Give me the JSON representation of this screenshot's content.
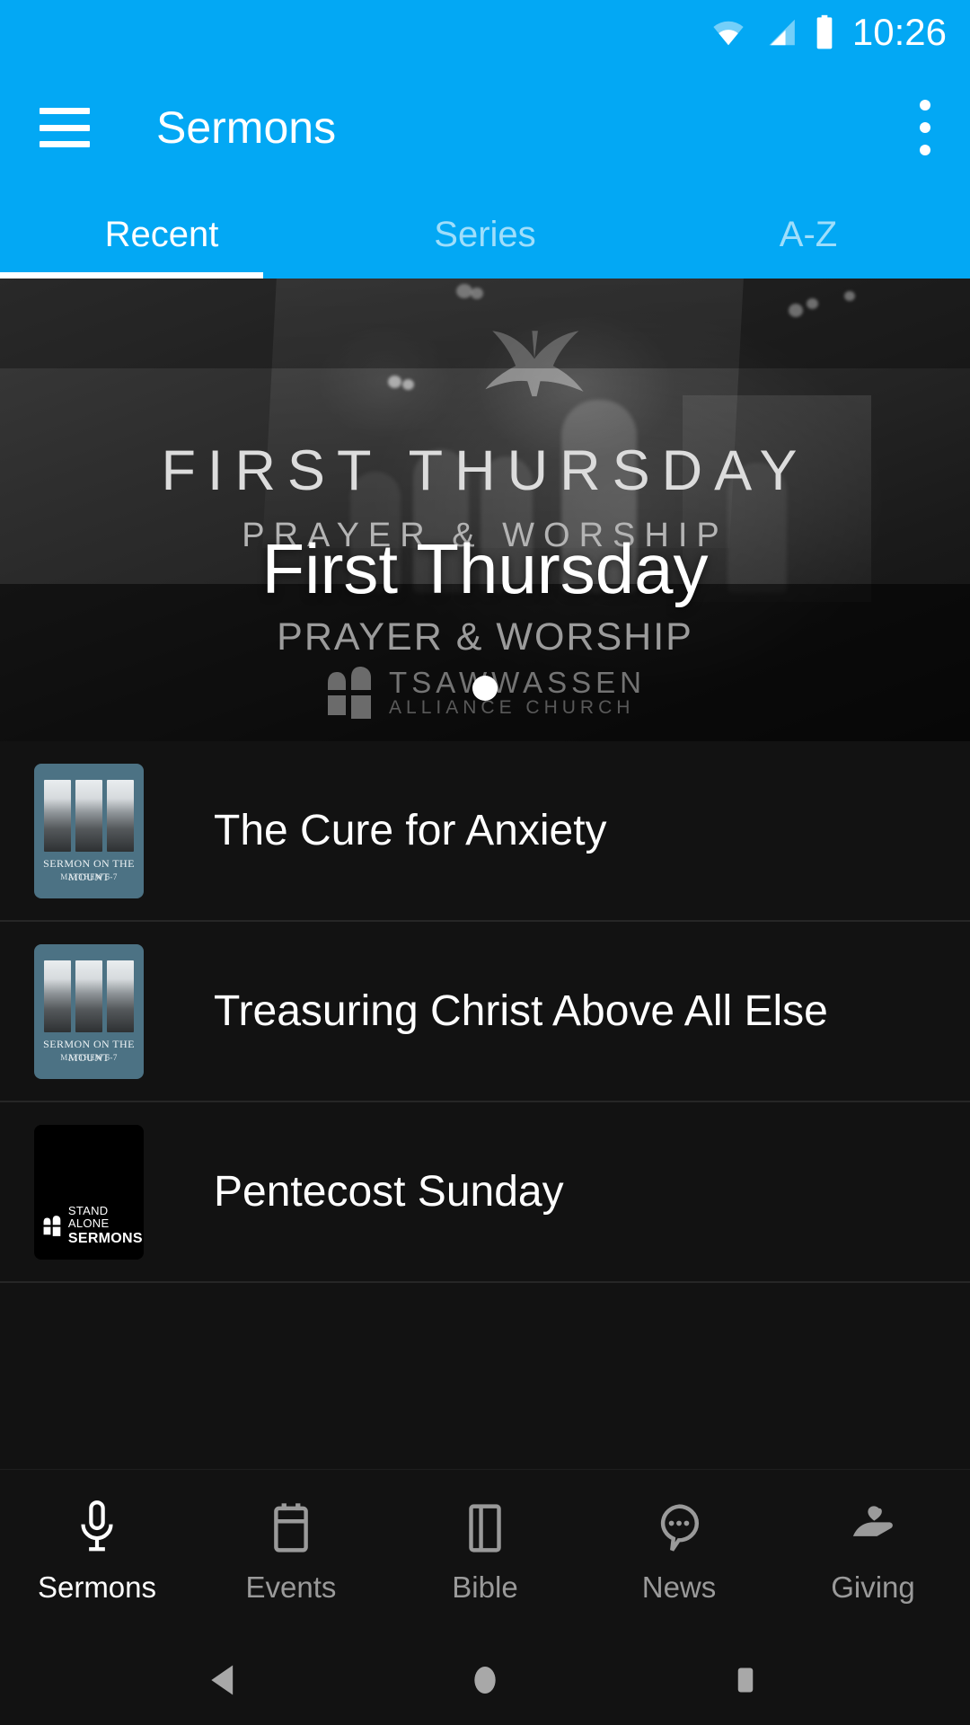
{
  "status_bar": {
    "time": "10:26",
    "icons": [
      "wifi-icon",
      "cellular-signal-icon",
      "battery-icon"
    ]
  },
  "app_bar": {
    "title": "Sermons",
    "menu_icon": "hamburger-menu-icon",
    "overflow_icon": "overflow-menu-icon"
  },
  "tabs": {
    "items": [
      {
        "label": "Recent",
        "active": true
      },
      {
        "label": "Series",
        "active": false
      },
      {
        "label": "A-Z",
        "active": false
      }
    ]
  },
  "hero": {
    "overlay_title": "First Thursday",
    "artwork": {
      "title": "FIRST THURSDAY",
      "subtitle": "PRAYER & WORSHIP",
      "subtitle2": "PRAYER & WORSHIP",
      "logo_line1": "TSAWWASSEN",
      "logo_line2": "ALLIANCE CHURCH"
    },
    "page_indicator_count": 1,
    "page_indicator_active": 0
  },
  "sermon_list": [
    {
      "title": "The Cure for Anxiety",
      "thumb_style": "sotm",
      "thumb_caption1": "SERMON ON THE MOUNT",
      "thumb_caption2": "MATTHEW 5-7"
    },
    {
      "title": "Treasuring Christ Above All Else",
      "thumb_style": "sotm",
      "thumb_caption1": "SERMON ON THE MOUNT",
      "thumb_caption2": "MATTHEW 5-7"
    },
    {
      "title": "Pentecost Sunday",
      "thumb_style": "sas",
      "thumb_caption1": "STAND ALONE",
      "thumb_caption2": "SERMONS"
    }
  ],
  "bottom_nav": {
    "items": [
      {
        "label": "Sermons",
        "icon": "microphone-icon",
        "active": true
      },
      {
        "label": "Events",
        "icon": "calendar-icon",
        "active": false
      },
      {
        "label": "Bible",
        "icon": "book-icon",
        "active": false
      },
      {
        "label": "News",
        "icon": "chat-bubble-icon",
        "active": false
      },
      {
        "label": "Giving",
        "icon": "giving-hand-icon",
        "active": false
      }
    ]
  },
  "system_nav": {
    "back": "back-triangle-icon",
    "home": "home-circle-icon",
    "recents": "recents-square-icon"
  },
  "colors": {
    "accent_blue": "#03A8F4",
    "background": "#121212",
    "thumb_teal": "#4C7284",
    "active_text": "#FFFFFF",
    "inactive_text": "#9A9A9A"
  }
}
